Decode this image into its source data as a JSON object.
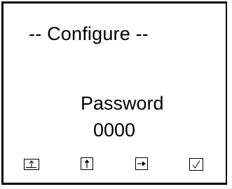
{
  "screen": {
    "title": "-- Configure --",
    "field_label": "Password",
    "field_value": "0000"
  },
  "softkeys": [
    {
      "icon": "escape-up-arrow-icon"
    },
    {
      "icon": "up-arrow-icon"
    },
    {
      "icon": "right-arrow-icon"
    },
    {
      "icon": "checkmark-icon"
    }
  ]
}
